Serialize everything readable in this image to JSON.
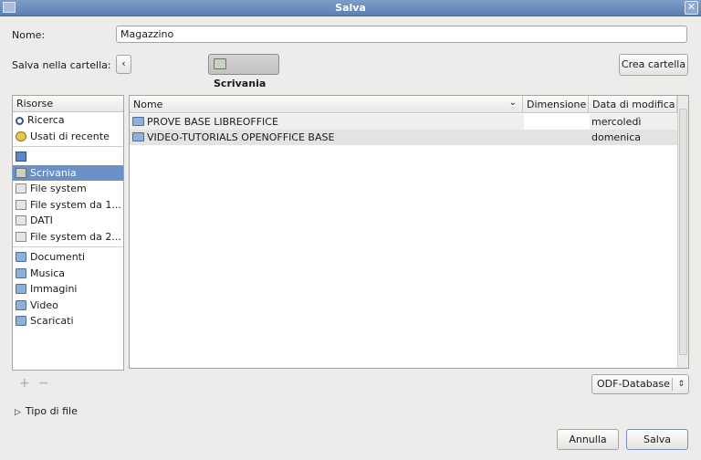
{
  "window": {
    "title": "Salva"
  },
  "form": {
    "name_label": "Nome:",
    "name_value": "Magazzino",
    "folder_label": "Salva nella cartella:",
    "back_glyph": "‹",
    "current_folder": "Scrivania",
    "create_folder_button": "Crea cartella"
  },
  "places": {
    "header": "Risorse",
    "items": [
      {
        "label": "Ricerca",
        "icon": "search-icon"
      },
      {
        "label": "Usati di recente",
        "icon": "clock-icon"
      },
      {
        "label": "",
        "icon": "home-folder-icon"
      },
      {
        "label": "Scrivania",
        "icon": "desktop-icon",
        "selected": true
      },
      {
        "label": "File system",
        "icon": "drive-icon"
      },
      {
        "label": "File system da 1...",
        "icon": "drive-icon"
      },
      {
        "label": "DATI",
        "icon": "drive-icon"
      },
      {
        "label": "File system da 2...",
        "icon": "drive-icon"
      },
      {
        "label": "Documenti",
        "icon": "folder-icon"
      },
      {
        "label": "Musica",
        "icon": "folder-icon"
      },
      {
        "label": "Immagini",
        "icon": "folder-icon"
      },
      {
        "label": "Video",
        "icon": "folder-icon"
      },
      {
        "label": "Scaricati",
        "icon": "folder-icon"
      }
    ],
    "add_glyph": "+",
    "remove_glyph": "−"
  },
  "files": {
    "columns": {
      "name": "Nome",
      "size": "Dimensione",
      "modified": "Data di modifica"
    },
    "rows": [
      {
        "name": "PROVE BASE LIBREOFFICE",
        "size": "",
        "modified": "mercoledì"
      },
      {
        "name": "VIDEO-TUTORIALS OPENOFFICE BASE",
        "size": "",
        "modified": "domenica"
      }
    ]
  },
  "filter": {
    "selected": "ODF-Database"
  },
  "file_type": {
    "label": "Tipo di file"
  },
  "actions": {
    "cancel": "Annulla",
    "save": "Salva"
  }
}
